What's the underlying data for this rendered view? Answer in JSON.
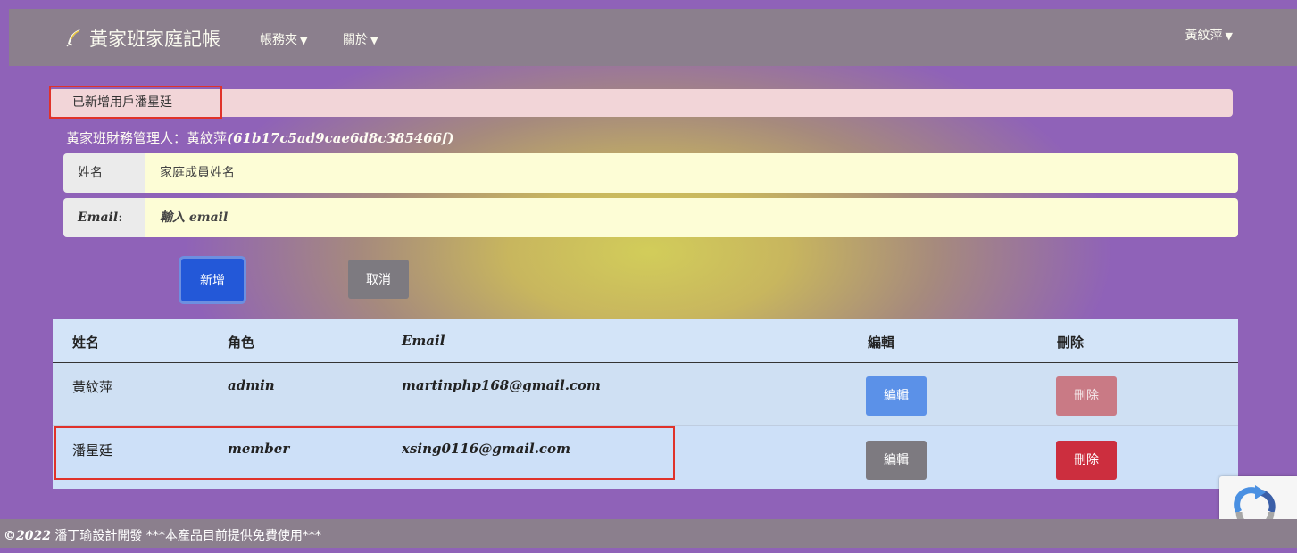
{
  "nav": {
    "brand": "黃家班家庭記帳",
    "menu_accounts": "帳務夾",
    "menu_about": "關於",
    "user": "黃紋萍"
  },
  "alert": {
    "message": "已新增用戶潘星廷"
  },
  "manager": {
    "label": "黃家班財務管理人：黃紋萍",
    "id": "(61b17c5ad9cae6d8c385466f)"
  },
  "form": {
    "name_label": "姓名",
    "name_placeholder": "家庭成員姓名",
    "email_label": "Email",
    "email_colon": ":",
    "email_placeholder": "輸入 email",
    "add_button": "新增",
    "cancel_button": "取消"
  },
  "table": {
    "headers": [
      "姓名",
      "角色",
      "Email",
      "編輯",
      "刪除"
    ],
    "rows": [
      {
        "name": "黃紋萍",
        "role": "admin",
        "email": "martinphp168@gmail.com",
        "edit": "編輯",
        "delete": "刪除"
      },
      {
        "name": "潘星廷",
        "role": "member",
        "email": "xsing0116@gmail.com",
        "edit": "編輯",
        "delete": "刪除"
      }
    ]
  },
  "footer": {
    "year": "©2022",
    "text": " 潘丁瑜設計開發 ***本產品目前提供免費使用***"
  },
  "colors": {
    "navbar": "#8b7f8d",
    "add_button": "#2358d8",
    "delete_active": "#cc2e3e",
    "highlight_annotation": "#e0322a"
  },
  "icons": {
    "brand": "quill-logo-icon",
    "recaptcha": "recaptcha-badge-icon"
  }
}
